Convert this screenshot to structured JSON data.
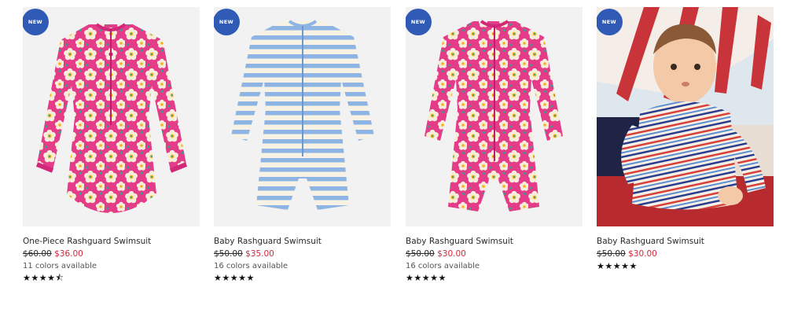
{
  "products": [
    {
      "badge": "NEW",
      "title": "One-Piece Rashguard Swimsuit",
      "orig_price": "$60.00",
      "sale_price": "$36.00",
      "colors": "11 colors available",
      "rating": 4.5
    },
    {
      "badge": "NEW",
      "title": "Baby Rashguard Swimsuit",
      "orig_price": "$50.00",
      "sale_price": "$35.00",
      "colors": "16 colors available",
      "rating": 5
    },
    {
      "badge": "NEW",
      "title": "Baby Rashguard Swimsuit",
      "orig_price": "$50.00",
      "sale_price": "$30.00",
      "colors": "16 colors available",
      "rating": 5
    },
    {
      "badge": "NEW",
      "title": "Baby Rashguard Swimsuit",
      "orig_price": "$50.00",
      "sale_price": "$30.00",
      "rating": 5
    }
  ],
  "colors": {
    "badge": "#2f5ab5",
    "sale": "#d2283a",
    "floral_pink": "#e53c8a",
    "stripe_blue": "#8eb4e3"
  }
}
